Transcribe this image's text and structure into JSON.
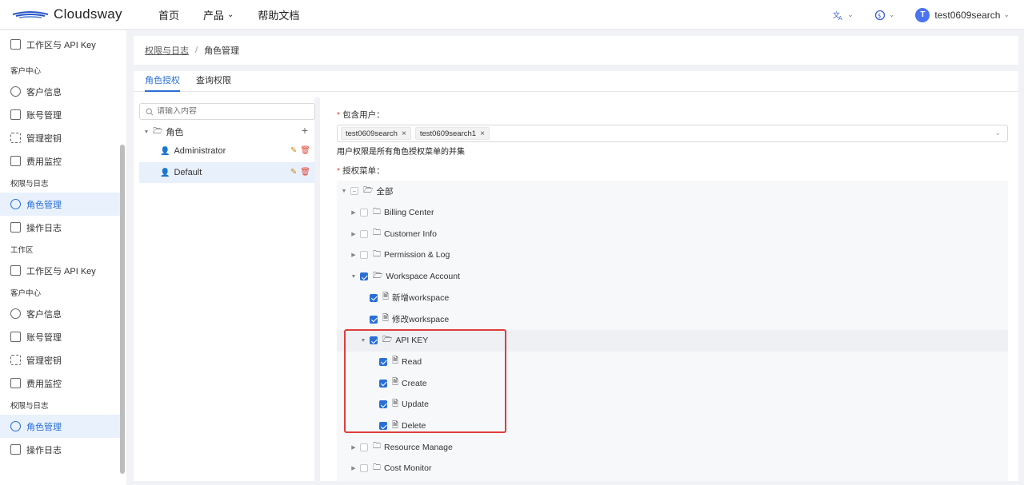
{
  "brand": {
    "name": "Cloudsway"
  },
  "topnav": {
    "items": [
      {
        "label": "首页"
      },
      {
        "label": "产品",
        "has_dropdown": true
      },
      {
        "label": "帮助文档"
      }
    ],
    "user": {
      "initial": "T",
      "name": "test0609search"
    }
  },
  "sidebar": {
    "item_workspace_top": "工作区与 API Key",
    "group_customer_1": "客户中心",
    "customer_info_1": "客户信息",
    "account_mgmt_1": "账号管理",
    "key_mgmt_1": "管理密钥",
    "cost_monitor_1": "费用监控",
    "group_perm_1": "权限与日志",
    "role_mgmt_1": "角色管理",
    "op_log_1": "操作日志",
    "group_workspace": "工作区",
    "workspace_api": "工作区与 API Key",
    "group_customer_2": "客户中心",
    "customer_info_2": "客户信息",
    "account_mgmt_2": "账号管理",
    "key_mgmt_2": "管理密钥",
    "cost_monitor_2": "费用监控",
    "group_perm_2": "权限与日志",
    "role_mgmt_2": "角色管理",
    "op_log_2": "操作日志"
  },
  "breadcrumb": {
    "parent": "权限与日志",
    "separator": "/",
    "current": "角色管理"
  },
  "tabs": {
    "role_auth": "角色授权",
    "query_perm": "查询权限"
  },
  "roles": {
    "search_placeholder": "请输入内容",
    "root": "角色",
    "items": [
      "Administrator",
      "Default"
    ]
  },
  "form": {
    "users_label": "包含用户：",
    "users": [
      "test0609search",
      "test0609search1"
    ],
    "note": "用户权限是所有角色授权菜单的并集",
    "menu_label": "授权菜单："
  },
  "tree": {
    "all": "全部",
    "billing": "Billing Center",
    "customer": "Customer Info",
    "permission": "Permission & Log",
    "workspace": "Workspace Account",
    "add_ws": "新增workspace",
    "edit_ws": "修改workspace",
    "api_key": "API KEY",
    "read": "Read",
    "create": "Create",
    "update": "Update",
    "delete": "Delete",
    "resource": "Resource Manage",
    "cost": "Cost Monitor"
  },
  "colors": {
    "accent": "#2a6fd6",
    "highlight_box": "#e03c3c",
    "delete": "#e0483a",
    "edit": "#c98a17"
  }
}
